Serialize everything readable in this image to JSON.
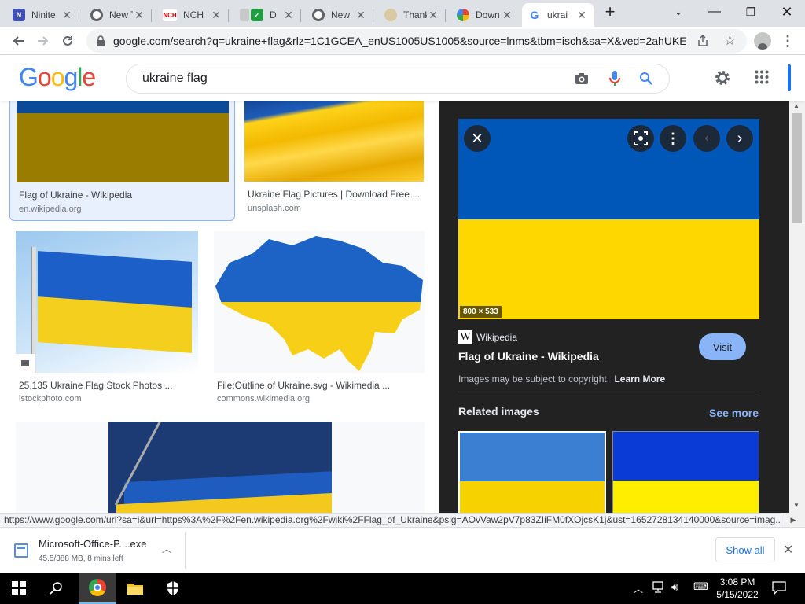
{
  "tabs": [
    {
      "label": "Ninite",
      "favicon": "ninite-icon"
    },
    {
      "label": "New T",
      "favicon": "chrome-icon"
    },
    {
      "label": "NCH",
      "favicon": "nch-icon"
    },
    {
      "label": "D",
      "favicon": "checkmark-icon"
    },
    {
      "label": "New",
      "favicon": "chrome-icon"
    },
    {
      "label": "Thank",
      "favicon": "thank-icon"
    },
    {
      "label": "Down",
      "favicon": "download-site-icon"
    },
    {
      "label": "ukrai",
      "favicon": "google-icon"
    }
  ],
  "address": {
    "url": "google.com/search?q=ukraine+flag&rlz=1C1GCEA_enUS1005US1005&source=lnms&tbm=isch&sa=X&ved=2ahUKE..."
  },
  "google": {
    "logo_letters": [
      "G",
      "o",
      "o",
      "g",
      "l",
      "e"
    ],
    "search_query": "ukraine flag"
  },
  "results": [
    {
      "caption": "Flag of Ukraine - Wikipedia",
      "source": "en.wikipedia.org"
    },
    {
      "caption": "Ukraine Flag Pictures | Download Free ...",
      "source": "unsplash.com"
    },
    {
      "caption": "25,135 Ukraine Flag Stock Photos ...",
      "source": "istockphoto.com"
    },
    {
      "caption": "File:Outline of Ukraine.svg - Wikimedia ...",
      "source": "commons.wikimedia.org"
    }
  ],
  "panel": {
    "dimensions": "800 × 533",
    "site_badge": "W",
    "site_name": "Wikipedia",
    "title": "Flag of Ukraine - Wikipedia",
    "visit_label": "Visit",
    "copyright_text": "Images may be subject to copyright.",
    "learn_more": "Learn More",
    "related_heading": "Related images",
    "see_more": "See more"
  },
  "status_url": "https://www.google.com/url?sa=i&url=https%3A%2F%2Fen.wikipedia.org%2Fwiki%2FFlag_of_Ukraine&psig=AOvVaw2pV7p83ZIiFM0fXOjcsK1j&ust=1652728134140000&source=imag...",
  "download": {
    "filename": "Microsoft-Office-P....exe",
    "progress": "45.5/388 MB, 8 mins left",
    "show_all_label": "Show all"
  },
  "taskbar": {
    "time": "3:08 PM",
    "date": "5/15/2022"
  },
  "colors": {
    "flag_blue": "#0057b7",
    "flag_yellow": "#ffd700",
    "visit_button": "#8ab4f8",
    "panel_bg": "#222222"
  }
}
